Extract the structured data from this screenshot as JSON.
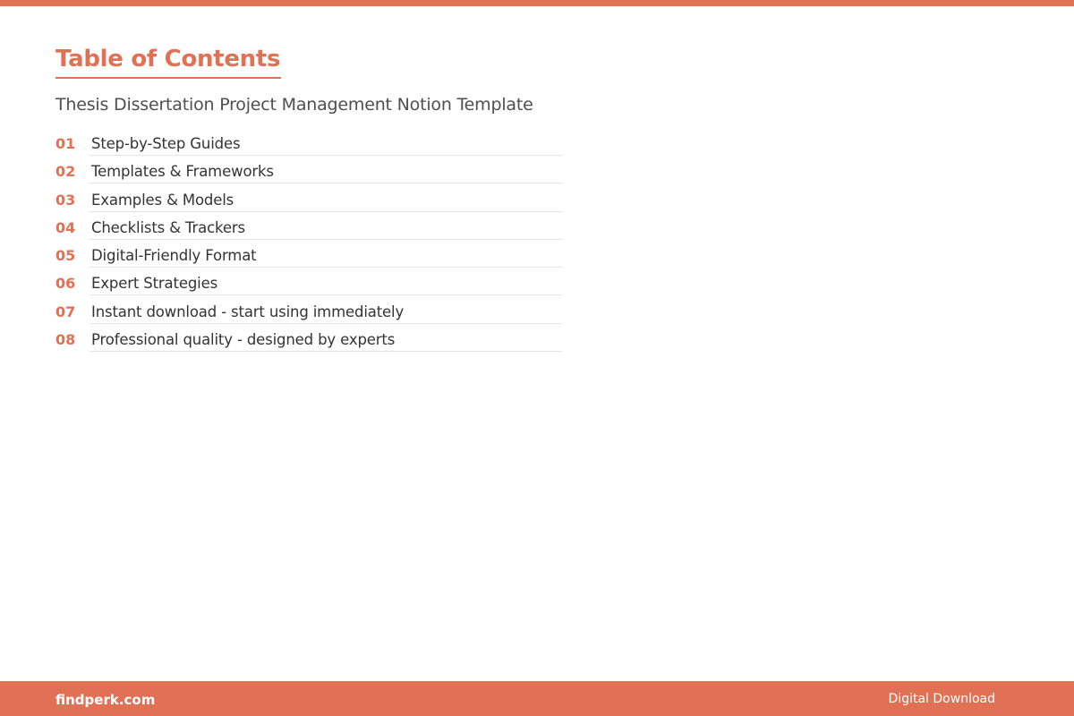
{
  "colors": {
    "accent": "#e07155",
    "text": "#333333",
    "subtitle": "#4f4f4f",
    "rule": "#e6e6e6",
    "footer_text": "#ffffff"
  },
  "title": "Table of Contents",
  "subtitle": "Thesis Dissertation Project Management Notion Template",
  "toc": [
    {
      "number": "01",
      "label": "Step-by-Step Guides"
    },
    {
      "number": "02",
      "label": "Templates & Frameworks"
    },
    {
      "number": "03",
      "label": "Examples & Models"
    },
    {
      "number": "04",
      "label": "Checklists & Trackers"
    },
    {
      "number": "05",
      "label": "Digital-Friendly Format"
    },
    {
      "number": "06",
      "label": "Expert Strategies"
    },
    {
      "number": "07",
      "label": "Instant download - start using immediately"
    },
    {
      "number": "08",
      "label": "Professional quality - designed by experts"
    }
  ],
  "footer": {
    "brand": "findperk.com",
    "tag": "Digital Download"
  }
}
